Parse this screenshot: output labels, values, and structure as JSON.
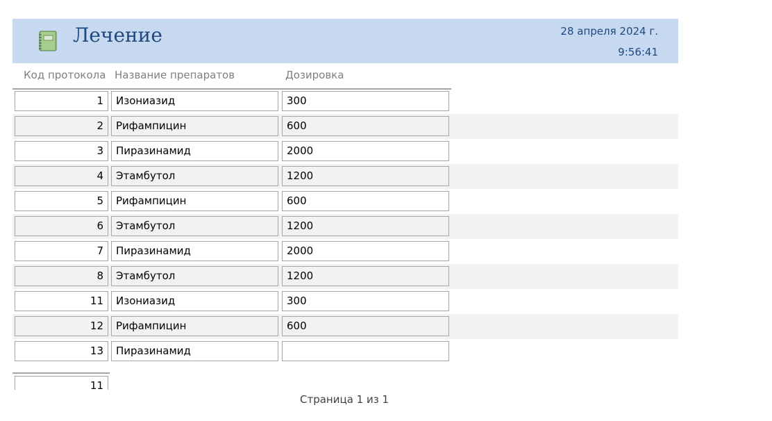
{
  "report": {
    "title": "Лечение",
    "date": "28 апреля 2024 г.",
    "time": "9:56:41",
    "icon": "notebook-icon"
  },
  "columns": {
    "code": "Код протокола",
    "name": "Название препаратов",
    "dose": "Дозировка"
  },
  "rows": [
    {
      "code": "1",
      "name": "Изониазид",
      "dose": "300"
    },
    {
      "code": "2",
      "name": "Рифампицин",
      "dose": "600"
    },
    {
      "code": "3",
      "name": "Пиразинамид",
      "dose": "2000"
    },
    {
      "code": "4",
      "name": "Этамбутол",
      "dose": "1200"
    },
    {
      "code": "5",
      "name": "Рифампицин",
      "dose": "600"
    },
    {
      "code": "6",
      "name": "Этамбутол",
      "dose": "1200"
    },
    {
      "code": "7",
      "name": "Пиразинамид",
      "dose": "2000"
    },
    {
      "code": "8",
      "name": "Этамбутол",
      "dose": "1200"
    },
    {
      "code": "11",
      "name": "Изониазид",
      "dose": "300"
    },
    {
      "code": "12",
      "name": "Рифампицин",
      "dose": "600"
    },
    {
      "code": "13",
      "name": "Пиразинамид",
      "dose": ""
    }
  ],
  "footer": {
    "count": "11",
    "page": "Страница 1 из 1"
  },
  "colors": {
    "header_background": "#c6d9f1",
    "title_color": "#1f497d",
    "alternate_row": "#f2f2f2",
    "border": "#a5a5a5"
  }
}
